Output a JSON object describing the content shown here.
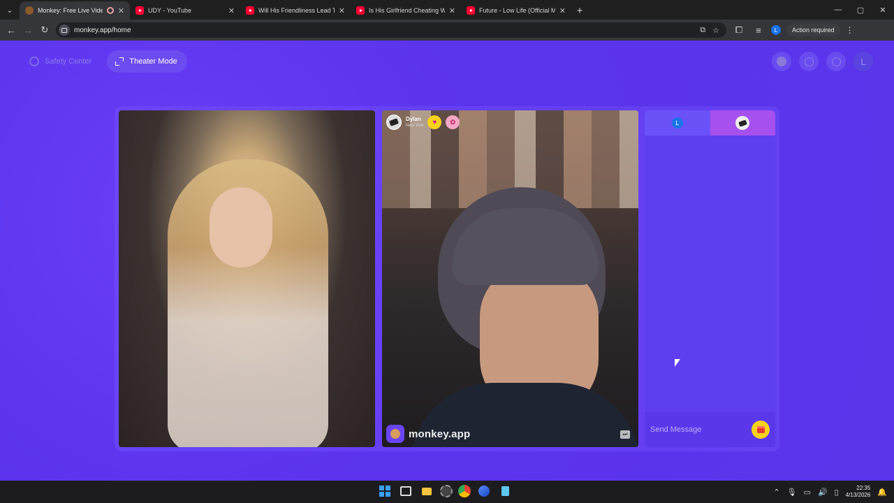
{
  "browser": {
    "tabs": [
      {
        "title": "Monkey: Free Live Video Ch",
        "active": true,
        "favicon": "monkey-icon",
        "recording": true
      },
      {
        "title": "UDY - YouTube",
        "active": false,
        "favicon": "youtube-icon"
      },
      {
        "title": "Will His Friendliness Lead To Ch",
        "active": false,
        "favicon": "youtube-icon"
      },
      {
        "title": "Is His Girlfriend Cheating With",
        "active": false,
        "favicon": "youtube-icon"
      },
      {
        "title": "Future - Low Life (Official Music",
        "active": false,
        "favicon": "youtube-icon"
      }
    ],
    "tab_close_glyph": "✕",
    "new_tab_glyph": "+",
    "window_controls": {
      "minimize": "—",
      "maximize": "▢",
      "close": "✕"
    },
    "url": "monkey.app/home",
    "profile_initial": "L",
    "action_required": "Action required"
  },
  "page": {
    "safety_center": "Safety Center",
    "theater_mode": "Theater Mode",
    "header_avatar_initial": "L",
    "peer": {
      "name": "Dylan",
      "location": "New York"
    },
    "brand": "monkey.app",
    "chat": {
      "me_initial": "L",
      "placeholder": "Send Message"
    },
    "colors": {
      "page_bg": "#5b34ee",
      "chat_peer_tab": "#a650ee",
      "gift_button": "#f7d21c"
    }
  },
  "taskbar": {
    "time": "22:35",
    "date": "4/13/2026"
  }
}
